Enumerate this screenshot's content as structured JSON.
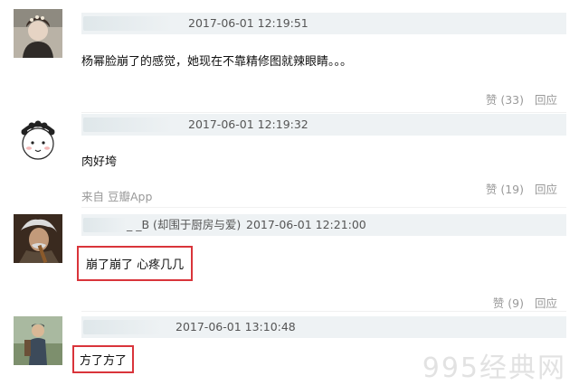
{
  "comments": [
    {
      "time": "2017-06-01 12:19:51",
      "text": "杨幂脸崩了的感觉，她现在不靠精修图就辣眼睛。。。",
      "like_label": "赞",
      "like_count": "(33)",
      "reply_label": "回应"
    },
    {
      "time": "2017-06-01 12:19:32",
      "text": "肉好垮",
      "source": "来自 豆瓣App",
      "like_label": "赞",
      "like_count": "(19)",
      "reply_label": "回应"
    },
    {
      "name_suffix": "_ _B (却围于厨房与爱)",
      "time": "2017-06-01 12:21:00",
      "text": "崩了崩了 心疼几几",
      "like_label": "赞",
      "like_count": "(9)",
      "reply_label": "回应"
    },
    {
      "time": "2017-06-01 13:10:48",
      "text": "方了方了"
    }
  ],
  "watermark": "995经典网"
}
